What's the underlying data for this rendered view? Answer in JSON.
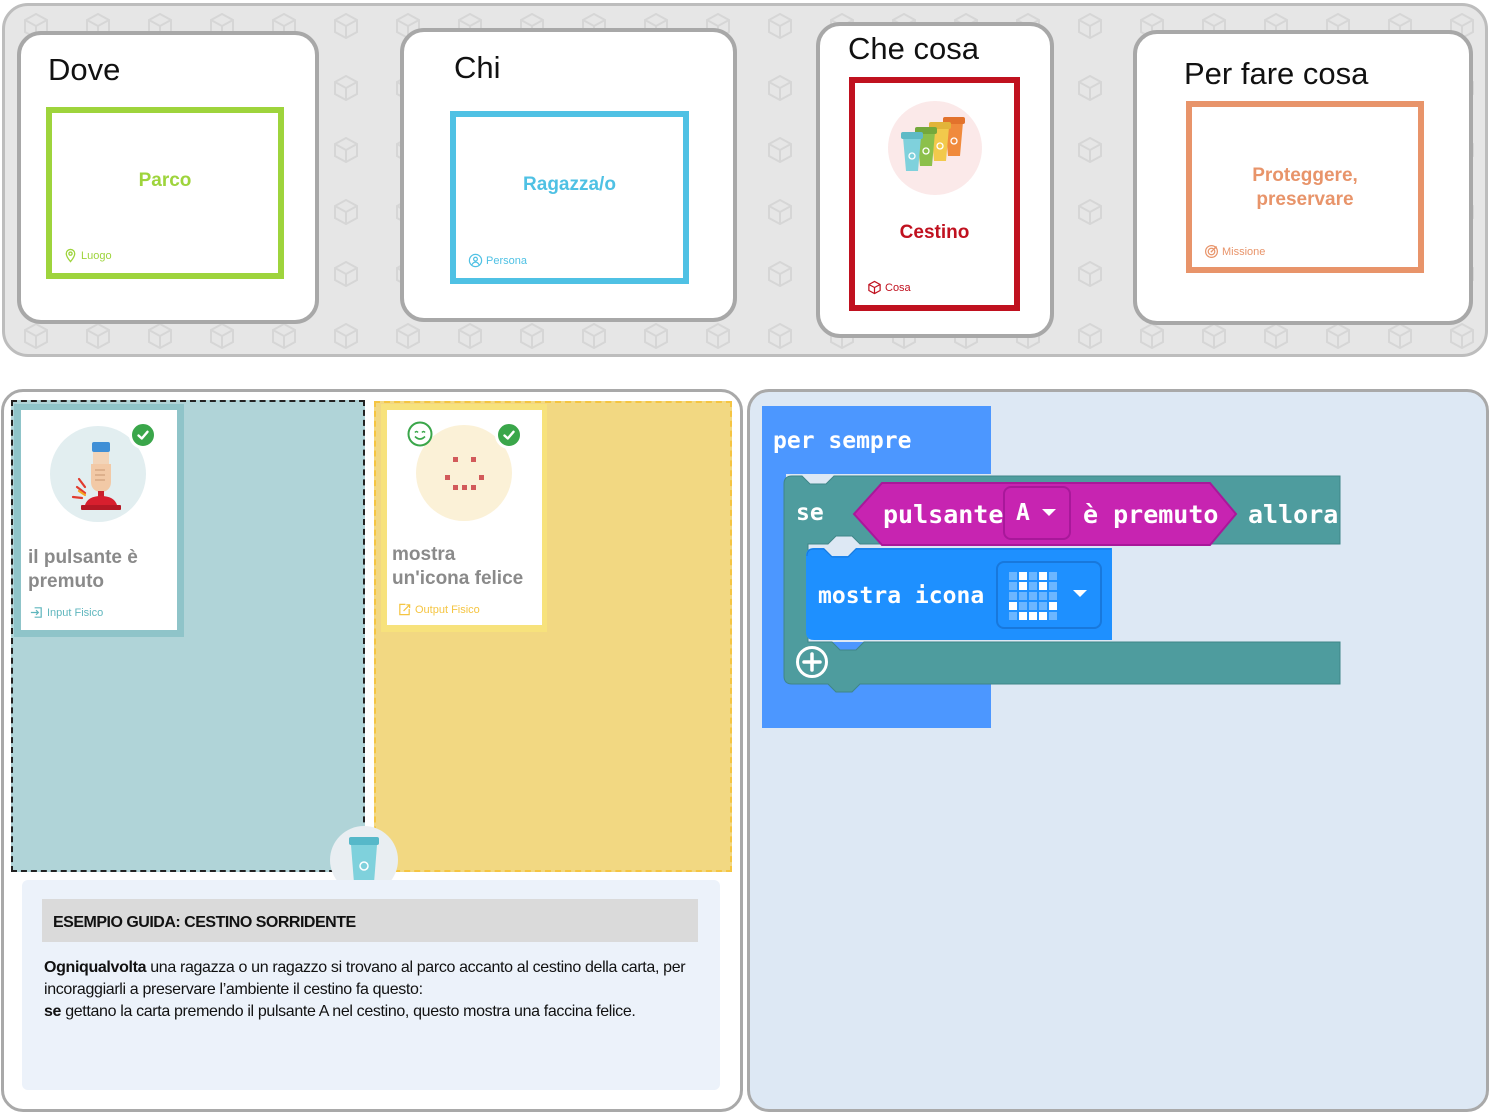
{
  "slots": [
    {
      "title": "Dove",
      "card_label": "Parco",
      "card_tag": "Luogo",
      "color": "#9ed43c",
      "tag_icon": "location-pin-icon"
    },
    {
      "title": "Chi",
      "card_label": "Ragazza/o",
      "card_tag": "Persona",
      "color": "#4fc1e4",
      "tag_icon": "person-icon"
    },
    {
      "title": "Che cosa",
      "card_label": "Cestino",
      "card_tag": "Cosa",
      "color": "#c0111f",
      "tag_icon": "cube-icon",
      "image": "recycling-bins-icon"
    },
    {
      "title": "Per fare cosa",
      "card_label": "Proteggere,\npreservare",
      "card_tag": "Missione",
      "color": "#e8946a",
      "tag_icon": "target-icon"
    }
  ],
  "actions": [
    {
      "label": "il pulsante è premuto",
      "tag": "Input Fisico",
      "icon": "button-press-icon",
      "zone_color": "#b0d4d8",
      "tag_color": "#5fb6bd"
    },
    {
      "label": "mostra un'icona felice",
      "tag": "Output Fisico",
      "icon": "smiley-led-icon",
      "zone_color": "#f2d882",
      "tag_color": "#f5c542"
    }
  ],
  "guide": {
    "title": "ESEMPIO GUIDA: CESTINO SORRIDENTE",
    "bold1": "Ogniqualvolta",
    "text1": " una ragazza o un ragazzo si trovano al parco accanto al cestino della carta, per incoraggiarli a preservare l’ambiente il cestino fa questo:",
    "bold2": "se",
    "text2": " gettano la carta premendo il pulsante A nel cestino, questo mostra una faccina felice."
  },
  "code": {
    "forever": "per sempre",
    "if": "se",
    "button_label": "pulsante",
    "button_value": "A",
    "pressed": "è premuto",
    "then": "allora",
    "show_icon": "mostra icona",
    "colors": {
      "loops": "#4c97ff",
      "logic": "#5c9ca0",
      "input": "#c724b1",
      "basic": "#1e90ff"
    }
  }
}
